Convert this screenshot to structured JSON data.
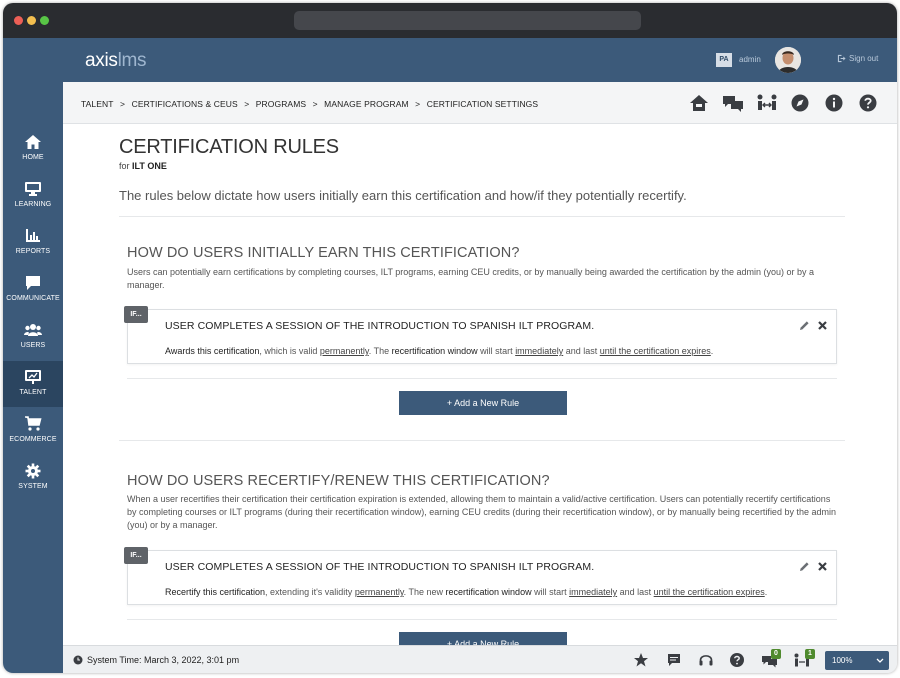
{
  "app": {
    "logo_main": "axis",
    "logo_light": "lms"
  },
  "header": {
    "user_initials": "PA",
    "user_name": "admin",
    "signout_label": "Sign out"
  },
  "sidebar": {
    "items": [
      {
        "label": "HOME",
        "icon": "home-icon"
      },
      {
        "label": "LEARNING",
        "icon": "monitor-icon"
      },
      {
        "label": "REPORTS",
        "icon": "bar-chart-icon"
      },
      {
        "label": "COMMUNICATE",
        "icon": "chat-icon"
      },
      {
        "label": "USERS",
        "icon": "users-icon"
      },
      {
        "label": "TALENT",
        "icon": "presentation-icon",
        "active": true
      },
      {
        "label": "ECOMMERCE",
        "icon": "cart-icon"
      },
      {
        "label": "SYSTEM",
        "icon": "gear-icon"
      }
    ]
  },
  "breadcrumb": {
    "items": [
      "TALENT",
      ">",
      "CERTIFICATIONS & CEUS",
      ">",
      "PROGRAMS",
      ">",
      "MANAGE PROGRAM",
      ">",
      "CERTIFICATION SETTINGS"
    ]
  },
  "page": {
    "title": "CERTIFICATION RULES",
    "sub_prefix": "for",
    "sub_name": "ILT ONE",
    "intro": "The rules below dictate how users initially earn this certification and how/if they potentially recertify."
  },
  "section1": {
    "title": "HOW DO USERS INITIALLY EARN THIS CERTIFICATION?",
    "desc": "Users can potentially earn certifications by completing courses, ILT programs, earning CEU credits, or by manually being awarded the certification by the admin (you) or by a manager.",
    "rule": {
      "tag": "IF...",
      "title": "USER COMPLETES A SESSION OF THE INTRODUCTION TO SPANISH ILT PROGRAM.",
      "d1": "Awards this certification",
      "d2": ", which is valid ",
      "d3": "permanently",
      "d4": ". The ",
      "d5": "recertification window",
      "d6": " will start ",
      "d7": "immediately",
      "d8": " and last ",
      "d9": "until the certification expires",
      "d10": "."
    },
    "add_label": "+ Add a New Rule"
  },
  "section2": {
    "title": "HOW DO USERS RECERTIFY/RENEW THIS CERTIFICATION?",
    "desc": "When a user recertifies their certification their certification expiration is extended, allowing them to maintain a valid/active certification. Users can potentially recertify certifications by completing courses or ILT programs (during their recertification window), earning CEU credits (during their recertification window), or by manually being recertified by the admin (you) or by a manager.",
    "rule": {
      "tag": "IF...",
      "title": "USER COMPLETES A SESSION OF THE INTRODUCTION TO SPANISH ILT PROGRAM.",
      "d1": "Recertify this certification",
      "d2": ", extending it's validity ",
      "d3": "permanently",
      "d4": ". The new ",
      "d5": "recertification window",
      "d6": " will start ",
      "d7": "immediately",
      "d8": " and last ",
      "d9": "until the certification expires",
      "d10": "."
    },
    "add_label": "+ Add a New Rule"
  },
  "statusbar": {
    "system_time_label": "System Time: March 3, 2022, 3:01 pm",
    "chat_badge": "0",
    "connections_badge": "1",
    "zoom": "100%"
  },
  "colors": {
    "brand": "#3c5a7a",
    "brand_dark": "#2b4560",
    "badge": "#4f8a2e"
  }
}
